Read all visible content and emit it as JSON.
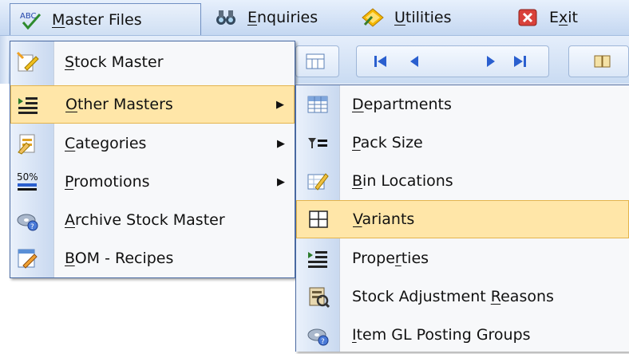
{
  "menubar": {
    "items": [
      {
        "label_pre": "",
        "label_u": "M",
        "label_post": "aster Files",
        "icon": "abc-check-icon",
        "state": "open"
      },
      {
        "label_pre": "",
        "label_u": "E",
        "label_post": "nquiries",
        "icon": "binoculars-icon",
        "state": "normal"
      },
      {
        "label_pre": "",
        "label_u": "U",
        "label_post": "tilities",
        "icon": "diamond-icon",
        "state": "normal"
      },
      {
        "label_pre": "E",
        "label_u": "x",
        "label_post": "it",
        "icon": "close-red-icon",
        "state": "normal"
      }
    ]
  },
  "master_files_menu": {
    "items": [
      {
        "pre": "",
        "u": "S",
        "post": "tock Master",
        "icon": "stock-master-icon",
        "submenu": false,
        "highlighted": false
      },
      {
        "pre": "",
        "u": "O",
        "post": "ther Masters",
        "icon": "list-indent-icon",
        "submenu": true,
        "highlighted": true
      },
      {
        "pre": "",
        "u": "C",
        "post": "ategories",
        "icon": "categories-icon",
        "submenu": true,
        "highlighted": false
      },
      {
        "pre": "",
        "u": "P",
        "post": "romotions",
        "icon": "percent-off-icon",
        "submenu": true,
        "highlighted": false
      },
      {
        "pre": "",
        "u": "A",
        "post": "rchive Stock Master",
        "icon": "archive-disc-icon",
        "submenu": false,
        "highlighted": false
      },
      {
        "pre": "",
        "u": "B",
        "post": "OM - Recipes",
        "icon": "recipe-edit-icon",
        "submenu": false,
        "highlighted": false
      }
    ]
  },
  "other_masters_submenu": {
    "items": [
      {
        "pre": "",
        "u": "D",
        "post": "epartments",
        "icon": "departments-grid-icon",
        "highlighted": false
      },
      {
        "pre": "",
        "u": "P",
        "post": "ack Size",
        "icon": "filter-list-icon",
        "highlighted": false
      },
      {
        "pre": "",
        "u": "B",
        "post": "in Locations",
        "icon": "bin-edit-icon",
        "highlighted": false
      },
      {
        "pre": "",
        "u": "V",
        "post": "ariants",
        "icon": "table-grid-icon",
        "highlighted": true
      },
      {
        "pre": "Prope",
        "u": "r",
        "post": "ties",
        "icon": "list-indent-icon",
        "highlighted": false
      },
      {
        "pre": "Stock Adjustment ",
        "u": "R",
        "post": "easons",
        "icon": "adjust-book-icon",
        "highlighted": false
      },
      {
        "pre": "",
        "u": "I",
        "post": "tem GL Posting Groups",
        "icon": "archive-disc-icon",
        "highlighted": false
      }
    ]
  },
  "colors": {
    "highlight_bg": "#ffe6a8",
    "highlight_border": "#e4b44c",
    "menu_border": "#4a6aa2",
    "menubar_top": "#e7f0fc",
    "menubar_bottom": "#c4d7f1"
  }
}
